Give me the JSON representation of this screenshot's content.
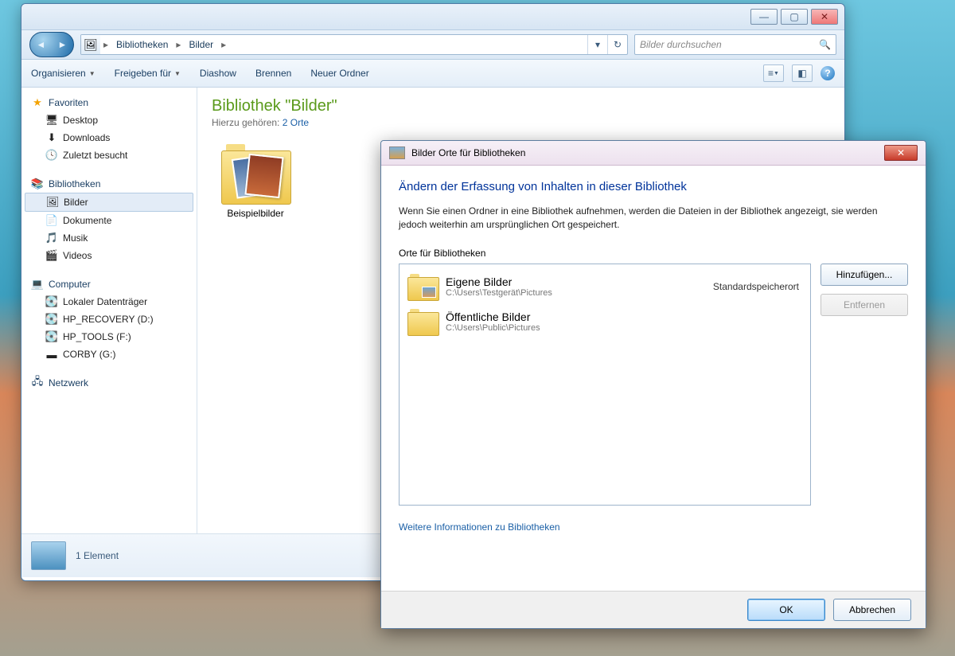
{
  "explorer": {
    "breadcrumb": {
      "seg1": "Bibliotheken",
      "seg2": "Bilder"
    },
    "search_placeholder": "Bilder durchsuchen",
    "cmdbar": {
      "organize": "Organisieren",
      "share": "Freigeben für",
      "slideshow": "Diashow",
      "burn": "Brennen",
      "newfolder": "Neuer Ordner"
    },
    "sidebar": {
      "favorites": {
        "label": "Favoriten",
        "items": [
          "Desktop",
          "Downloads",
          "Zuletzt besucht"
        ]
      },
      "libraries": {
        "label": "Bibliotheken",
        "items": [
          "Bilder",
          "Dokumente",
          "Musik",
          "Videos"
        ]
      },
      "computer": {
        "label": "Computer",
        "items": [
          "Lokaler Datenträger",
          "HP_RECOVERY (D:)",
          "HP_TOOLS (F:)",
          "CORBY (G:)"
        ]
      },
      "network": {
        "label": "Netzwerk"
      }
    },
    "content": {
      "title": "Bibliothek \"Bilder\"",
      "subtitle_prefix": "Hierzu gehören:",
      "subtitle_link": "2 Orte",
      "folder": "Beispielbilder"
    },
    "statusbar": "1 Element"
  },
  "dialog": {
    "title": "Bilder Orte für Bibliotheken",
    "heading": "Ändern der Erfassung von Inhalten in dieser Bibliothek",
    "desc": "Wenn Sie einen Ordner in eine Bibliothek aufnehmen, werden die Dateien in der Bibliothek angezeigt, sie werden jedoch weiterhin am ursprünglichen Ort gespeichert.",
    "list_label": "Orte für Bibliotheken",
    "locations": [
      {
        "name": "Eigene Bilder",
        "path": "C:\\Users\\Testgerät\\Pictures",
        "badge": "Standardspeicherort"
      },
      {
        "name": "Öffentliche Bilder",
        "path": "C:\\Users\\Public\\Pictures",
        "badge": ""
      }
    ],
    "btn_add": "Hinzufügen...",
    "btn_remove": "Entfernen",
    "link_more": "Weitere Informationen zu Bibliotheken",
    "btn_ok": "OK",
    "btn_cancel": "Abbrechen"
  }
}
